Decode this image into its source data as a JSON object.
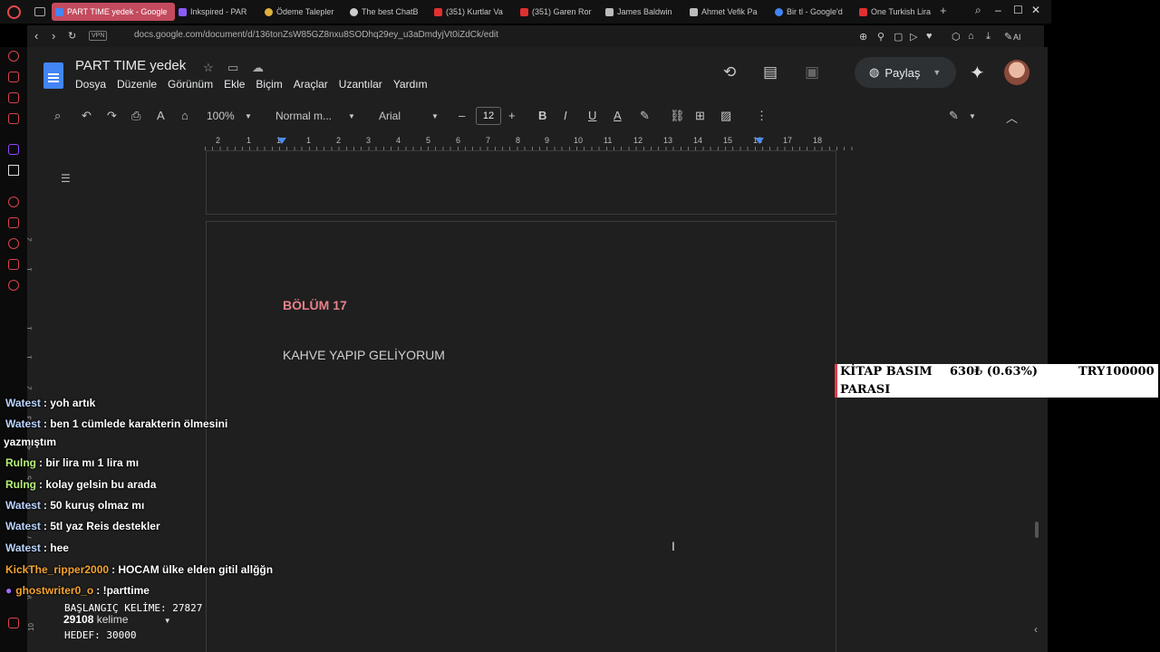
{
  "browser": {
    "tabs": [
      {
        "title": "PART TIME yedek - Google",
        "active": true,
        "color": "#4285f4"
      },
      {
        "title": "Inkspired - PAR",
        "active": false,
        "color": "#8a5cf6"
      },
      {
        "title": "Ödeme Talepler",
        "active": false,
        "color": "#e0b03c"
      },
      {
        "title": "The best ChatB",
        "active": false,
        "color": "#cccccc"
      },
      {
        "title": "(351) Kurtlar Va",
        "active": false,
        "color": "#e03030"
      },
      {
        "title": "(351) Garen Ror",
        "active": false,
        "color": "#e03030"
      },
      {
        "title": "James Baldwin",
        "active": false,
        "color": "#bbbbbb"
      },
      {
        "title": "Ahmet Vefik Pa",
        "active": false,
        "color": "#bbbbbb"
      },
      {
        "title": "Bir tl - Google'd",
        "active": false,
        "color": "#4285f4"
      },
      {
        "title": "One Turkish Lira",
        "active": false,
        "color": "#e03030"
      }
    ],
    "new_tab": "+",
    "vpn_label": "VPN",
    "url": "docs.google.com/document/d/136tonZsW85GZ8nxu8SODhq29ey_u3aDmdyjVt0iZdCk/edit",
    "ai_label": "AI"
  },
  "docs": {
    "title": "PART TIME yedek",
    "menu": [
      "Dosya",
      "Düzenle",
      "Görünüm",
      "Ekle",
      "Biçim",
      "Araçlar",
      "Uzantılar",
      "Yardım"
    ],
    "share_label": "Paylaş",
    "toolbar": {
      "zoom": "100%",
      "style": "Normal m...",
      "font": "Arial",
      "font_size": "12"
    },
    "ruler_numbers": [
      "2",
      "1",
      "1",
      "1",
      "2",
      "3",
      "4",
      "5",
      "6",
      "7",
      "8",
      "9",
      "10",
      "11",
      "12",
      "13",
      "14",
      "15",
      "16",
      "17",
      "18"
    ],
    "vruler_numbers": [
      "2",
      "1",
      "1",
      "1",
      "2",
      "3",
      "4",
      "5",
      "6",
      "7",
      "8",
      "9",
      "10",
      "11"
    ],
    "content": {
      "chapter": "BÖLÜM 17",
      "line": "KAHVE YAPIP GELİYORUM"
    },
    "word_count": {
      "value": "29108",
      "label": "kelime"
    }
  },
  "goal_box": {
    "label_line1": "KİTAP BASIM",
    "label_line2": "PARASI",
    "amount": "630₺ (0.63%)",
    "target": "TRY100000"
  },
  "chat": [
    {
      "user": "Watest",
      "user_color": "#b9d3ff",
      "text": ": yoh artık"
    },
    {
      "user": "Watest",
      "user_color": "#b9d3ff",
      "text": ": ben 1 cümlede karakterin ölmesini",
      "cont": "yazmıştım"
    },
    {
      "user": "Rulng",
      "user_color": "#b7f07a",
      "text": ": bir lira mı 1 lira mı"
    },
    {
      "user": "Rulng",
      "user_color": "#b7f07a",
      "text": ": kolay gelsin bu arada"
    },
    {
      "user": "Watest",
      "user_color": "#b9d3ff",
      "text": ": 50 kuruş olmaz mı"
    },
    {
      "user": "Watest",
      "user_color": "#b9d3ff",
      "text": ": 5tl yaz Reis destekler"
    },
    {
      "user": "Watest",
      "user_color": "#b9d3ff",
      "text": ": hee"
    },
    {
      "user": "KickThe_ripper2000",
      "user_color": "#f5a431",
      "text": ": HOCAM ülke elden gitil allğğn"
    },
    {
      "user": "ghostwriter0_o",
      "user_color": "#f5a431",
      "text": ": !parttime"
    }
  ],
  "stream_counter": {
    "start": "BAŞLANGIÇ KELİME: 27827",
    "target": "HEDEF: 30000"
  }
}
